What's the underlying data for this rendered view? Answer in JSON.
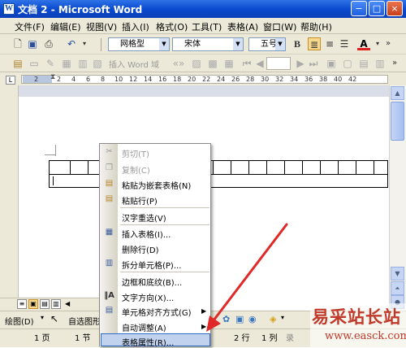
{
  "window": {
    "title": "文档 2 - Microsoft Word",
    "title_icon": "W",
    "minimize": "−",
    "maximize": "□",
    "close": "×"
  },
  "menubar": {
    "items": [
      "文件(F)",
      "编辑(E)",
      "视图(V)",
      "插入(I)",
      "格式(O)",
      "工具(T)",
      "表格(A)",
      "窗口(W)",
      "帮助(H)"
    ]
  },
  "toolbar1": {
    "style_value": "网格型",
    "font_value": "宋体",
    "size_value": "五号",
    "bold_label": "B",
    "font_color_label": "A"
  },
  "toolbar2": {
    "insert_word_label": "插入 Word 域"
  },
  "ruler": {
    "numbers": [
      "2",
      "2",
      "4",
      "6",
      "8",
      "10",
      "12",
      "14",
      "16",
      "18",
      "20",
      "22",
      "24",
      "26",
      "28",
      "30",
      "32",
      "34",
      "36",
      "38",
      "40",
      "42"
    ]
  },
  "context_menu": {
    "items": [
      {
        "label": "剪切(T)",
        "disabled": true,
        "icon": "scissors-icon"
      },
      {
        "label": "复制(C)",
        "disabled": true,
        "icon": "copy-icon"
      },
      {
        "label": "粘贴为嵌套表格(N)",
        "disabled": false,
        "icon": "paste-icon"
      },
      {
        "label": "粘贴行(P)",
        "disabled": false,
        "icon": "paste-icon"
      },
      {
        "label": "汉字重选(V)",
        "disabled": false,
        "icon": ""
      },
      {
        "label": "插入表格(I)...",
        "disabled": false,
        "icon": "table-icon"
      },
      {
        "label": "删除行(D)",
        "disabled": false,
        "icon": ""
      },
      {
        "label": "拆分单元格(P)...",
        "disabled": false,
        "icon": "split-icon"
      },
      {
        "label": "边框和底纹(B)...",
        "disabled": false,
        "icon": ""
      },
      {
        "label": "文字方向(X)...",
        "disabled": false,
        "icon": "text-direction-icon"
      },
      {
        "label": "单元格对齐方式(G)",
        "disabled": false,
        "icon": "align-icon",
        "submenu": true
      },
      {
        "label": "自动调整(A)",
        "disabled": false,
        "icon": "",
        "submenu": true
      },
      {
        "label": "表格属性(R)...",
        "disabled": false,
        "icon": "",
        "highlighted": true
      }
    ]
  },
  "drawbar": {
    "draw_label": "绘图(D)",
    "autoshape_label": "自选图形"
  },
  "statusbar": {
    "page": "1 页",
    "section": "1 节",
    "line": "2 行",
    "column": "1 列",
    "record": "录"
  },
  "watermark": {
    "text": "易采站长站",
    "url": "www.easck.com"
  }
}
